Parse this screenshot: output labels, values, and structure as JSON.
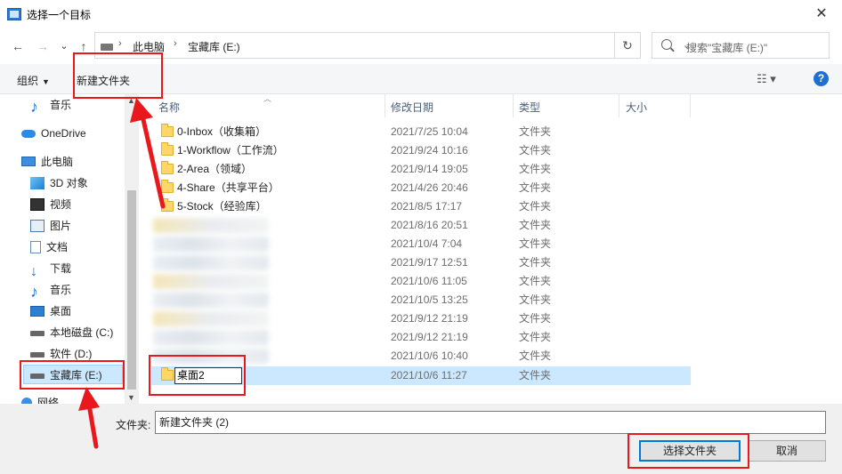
{
  "window": {
    "title": "选择一个目标",
    "close_glyph": "✕"
  },
  "nav": {
    "back_glyph": "←",
    "forward_glyph": "→",
    "recent_glyph": "⌄",
    "up_glyph": "↑",
    "breadcrumb": [
      "此电脑",
      "宝藏库 (E:)"
    ],
    "refresh_glyph": "↻",
    "search_placeholder": "搜索\"宝藏库 (E:)\""
  },
  "toolbar": {
    "organize": "组织",
    "new_folder": "新建文件夹",
    "help": "?"
  },
  "sidebar": {
    "items": [
      {
        "label": "音乐",
        "icon": "music-icon"
      },
      {
        "label": "OneDrive",
        "icon": "cloud-icon"
      },
      {
        "label": "此电脑",
        "icon": "pc-icon"
      },
      {
        "label": "3D 对象",
        "icon": "3d-objects-icon"
      },
      {
        "label": "视频",
        "icon": "video-icon"
      },
      {
        "label": "图片",
        "icon": "pictures-icon"
      },
      {
        "label": "文档",
        "icon": "documents-icon"
      },
      {
        "label": "下载",
        "icon": "download-icon"
      },
      {
        "label": "音乐",
        "icon": "music-icon"
      },
      {
        "label": "桌面",
        "icon": "desktop-icon"
      },
      {
        "label": "本地磁盘 (C:)",
        "icon": "drive-icon"
      },
      {
        "label": "软件 (D:)",
        "icon": "drive-icon"
      },
      {
        "label": "宝藏库 (E:)",
        "icon": "drive-icon"
      },
      {
        "label": "网络",
        "icon": "network-icon"
      }
    ]
  },
  "columns": {
    "name": "名称",
    "modified": "修改日期",
    "type": "类型",
    "size": "大小"
  },
  "files": [
    {
      "name": "0-Inbox（收集箱）",
      "date": "2021/7/25 10:04",
      "type": "文件夹"
    },
    {
      "name": "1-Workflow（工作流）",
      "date": "2021/9/24 10:16",
      "type": "文件夹"
    },
    {
      "name": "2-Area（领域）",
      "date": "2021/9/14 19:05",
      "type": "文件夹"
    },
    {
      "name": "4-Share（共享平台）",
      "date": "2021/4/26 20:46",
      "type": "文件夹"
    },
    {
      "name": "5-Stock（经验库）",
      "date": "2021/8/5 17:17",
      "type": "文件夹"
    },
    {
      "name": "",
      "date": "2021/8/16 20:51",
      "type": "文件夹"
    },
    {
      "name": "",
      "date": "2021/10/4 7:04",
      "type": "文件夹"
    },
    {
      "name": "",
      "date": "2021/9/17 12:51",
      "type": "文件夹"
    },
    {
      "name": "",
      "date": "2021/10/6 11:05",
      "type": "文件夹"
    },
    {
      "name": "",
      "date": "2021/10/5 13:25",
      "type": "文件夹"
    },
    {
      "name": "",
      "date": "2021/9/12 21:19",
      "type": "文件夹"
    },
    {
      "name": "",
      "date": "2021/9/12 21:19",
      "type": "文件夹"
    },
    {
      "name": "",
      "date": "2021/10/6 10:40",
      "type": "文件夹"
    },
    {
      "name": "桌面2",
      "date": "2021/10/6 11:27",
      "type": "文件夹"
    }
  ],
  "footer": {
    "folder_label": "文件夹:",
    "folder_value": "新建文件夹 (2)",
    "select_button": "选择文件夹",
    "cancel_button": "取消"
  },
  "colors": {
    "annotation_red": "#e8181d",
    "selection_blue": "#cce8ff",
    "accent_blue": "#0078d7"
  }
}
